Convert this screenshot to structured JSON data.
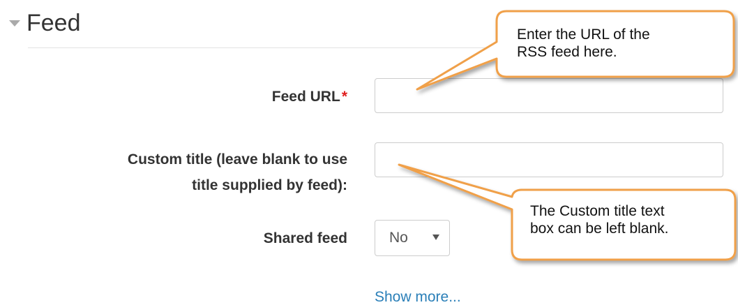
{
  "section": {
    "title": "Feed"
  },
  "fields": {
    "feed_url": {
      "label": "Feed URL",
      "required_marker": "*",
      "value": "",
      "placeholder": ""
    },
    "custom_title": {
      "label_line1": "Custom title (leave blank to use",
      "label_line2": "title supplied by feed):",
      "value": "",
      "placeholder": ""
    },
    "shared_feed": {
      "label": "Shared feed",
      "selected": "No"
    }
  },
  "links": {
    "show_more": "Show more..."
  },
  "callouts": [
    {
      "line1": "Enter the URL of the",
      "line2": "RSS feed here."
    },
    {
      "line1": "The Custom title text",
      "line2": "box can be left blank."
    }
  ],
  "colors": {
    "callout_fill": "#ffffff",
    "callout_border": "#f0a048",
    "link": "#2a7fb8",
    "required": "#e02020"
  },
  "icons": {
    "collapse": "triangle-down-icon"
  }
}
